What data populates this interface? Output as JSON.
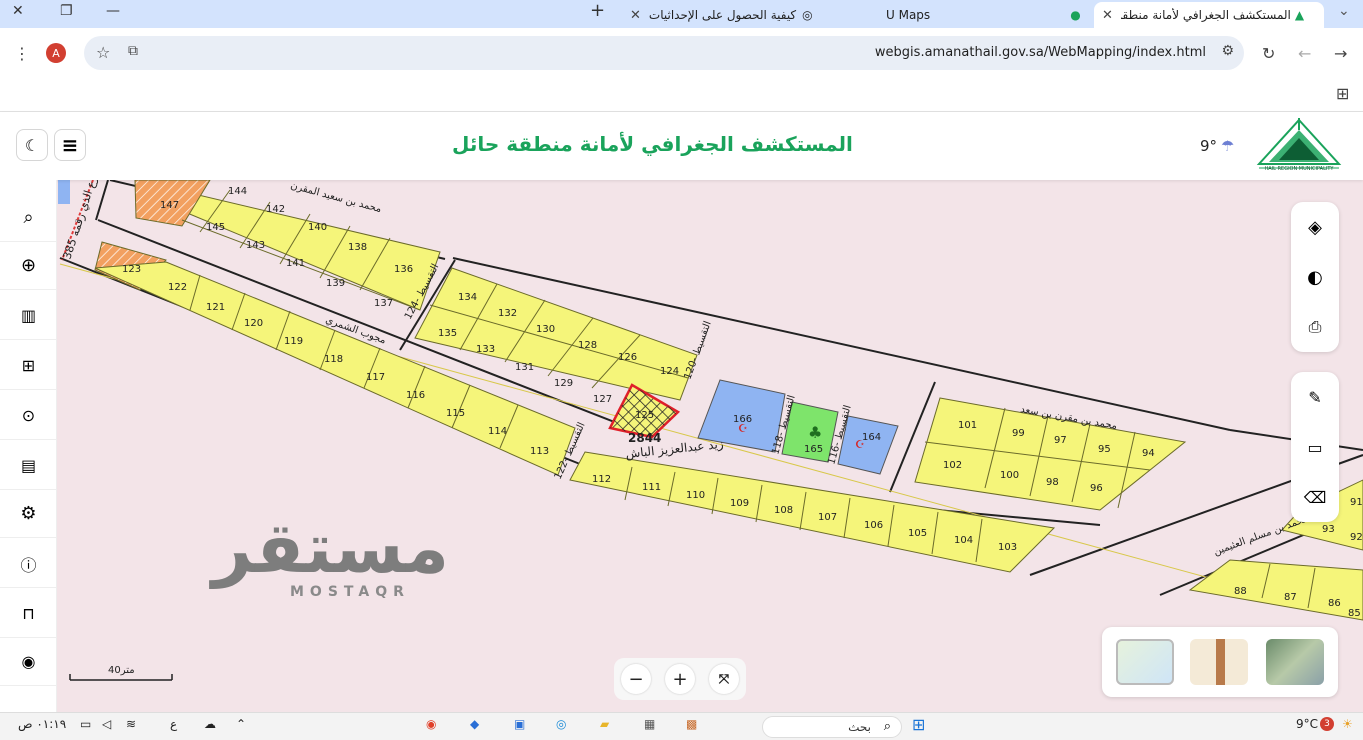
{
  "browser": {
    "tabs": [
      {
        "title": "المستكشف الجغرافي لأمانة منطقة",
        "active": true
      },
      {
        "title": "U Maps",
        "active": false
      },
      {
        "title": "كيفية الحصول على الإحداثيات",
        "active": false
      }
    ],
    "url": "webgis.amanathail.gov.sa/WebMapping/index.html",
    "profile_initial": "A"
  },
  "app": {
    "title": "المستكشف الجغرافي لأمانة منطقة حائل",
    "temperature": "9°",
    "logo_text": "أمانة منطقة حائل",
    "logo_subtext": "HAIL REGION MUNICIPALITY"
  },
  "map": {
    "selected_parcel": {
      "number": "125",
      "label": "2844"
    },
    "parcels_upper": [
      "147",
      "144",
      "142",
      "140",
      "138",
      "136",
      "145",
      "143",
      "141",
      "139",
      "137"
    ],
    "parcels_middle": [
      "134",
      "132",
      "130",
      "128",
      "126",
      "124",
      "135",
      "133",
      "131",
      "129",
      "127"
    ],
    "parcels_lower": [
      "123",
      "122",
      "121",
      "120",
      "119",
      "118",
      "117",
      "116",
      "115",
      "114",
      "113"
    ],
    "parcels_bottom": [
      "112",
      "111",
      "110",
      "109",
      "108",
      "107",
      "106",
      "105",
      "104",
      "103"
    ],
    "parcels_right": [
      "101",
      "99",
      "97",
      "95",
      "94",
      "102",
      "100",
      "98",
      "96"
    ],
    "parcels_far": [
      "88",
      "87",
      "86",
      "85",
      "93",
      "92",
      "91"
    ],
    "facilities": [
      {
        "number": "166",
        "type": "mosque"
      },
      {
        "number": "165",
        "type": "park"
      },
      {
        "number": "164",
        "type": "mosque"
      }
    ],
    "street_labels": [
      "زيد عبدالعزيز الباش",
      "الشارع الذي رقمه 385",
      "124- التقسيط",
      "120- التقسيط",
      "122- التقسيط",
      "118- التقسيط",
      "116- التقسيط",
      "محمد بن مقرن بن سعد",
      "محمد بن مسلم العثيمين",
      "محمد بن سعيد المقرن",
      "مجوب الشمري"
    ],
    "scale_label": "40متر"
  },
  "watermark": {
    "main": "مستقر",
    "sub": "MOSTAQR"
  },
  "taskbar": {
    "search": "بحث",
    "weather": "9°C",
    "badge": "3",
    "time": "٠١:١٩ ص",
    "lang": "ع"
  },
  "colors": {
    "brand_green": "#1aa35b",
    "parcel_yellow": "#f5f57a",
    "parcel_outline": "#6b6b2a",
    "service_blue": "#8fb4f2",
    "park_green": "#7ee46b",
    "map_bg": "#f3e4e8"
  }
}
